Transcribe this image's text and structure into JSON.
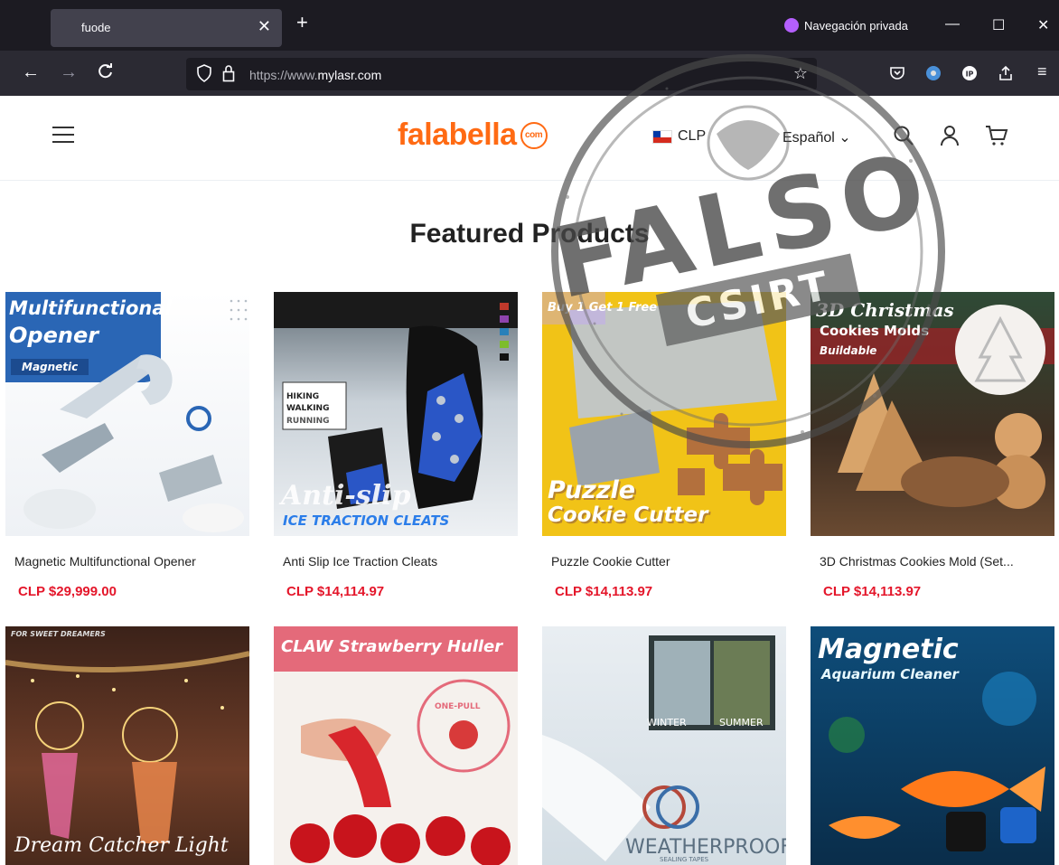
{
  "browser": {
    "tab_title": "fuode",
    "private_label": "Navegación privada",
    "url_dim": "https://www.",
    "url_domain": "mylasr.com"
  },
  "header": {
    "logo_text": "falabella",
    "logo_badge": "com",
    "currency": "CLP",
    "language": "Español"
  },
  "main": {
    "section_title": "Featured Products",
    "products": [
      {
        "name": "Magnetic Multifunctional Opener",
        "price": "CLP $29,999.00",
        "image_text": [
          "Multifunctional",
          "Opener",
          "Magnetic"
        ]
      },
      {
        "name": "Anti Slip Ice Traction Cleats",
        "price": "CLP $14,114.97",
        "image_text": [
          "HIKING",
          "WALKING",
          "RUNNING",
          "Anti-slip",
          "ICE TRACTION CLEATS"
        ]
      },
      {
        "name": "Puzzle Cookie Cutter",
        "price": "CLP $14,113.97",
        "image_text": [
          "Buy 1 Get 1 Free",
          "Puzzle",
          "Cookie Cutter"
        ]
      },
      {
        "name": "3D Christmas Cookies Mold (Set...",
        "price": "CLP $14,113.97",
        "image_text": [
          "3D Christmas",
          "Cookies Molds",
          "Buildable"
        ]
      },
      {
        "name": "",
        "price": "",
        "image_text": [
          "FOR SWEET DREAMERS",
          "Dream Catcher Light"
        ]
      },
      {
        "name": "",
        "price": "",
        "image_text": [
          "CLAW Strawberry Huller",
          "ONE-PULL"
        ]
      },
      {
        "name": "",
        "price": "",
        "image_text": [
          "WINTER",
          "SUMMER",
          "WEATHERPROOF",
          "SEALING TAPES"
        ]
      },
      {
        "name": "",
        "price": "",
        "image_text": [
          "Magnetic",
          "Aquarium Cleaner"
        ]
      }
    ]
  },
  "stamp": {
    "text": "FALSO",
    "subtext": "CSIRT"
  },
  "colors": {
    "brand": "#ff6a13",
    "price": "#e4162a",
    "chrome_dark": "#1c1b22",
    "chrome_toolbar": "#2b2a33"
  }
}
